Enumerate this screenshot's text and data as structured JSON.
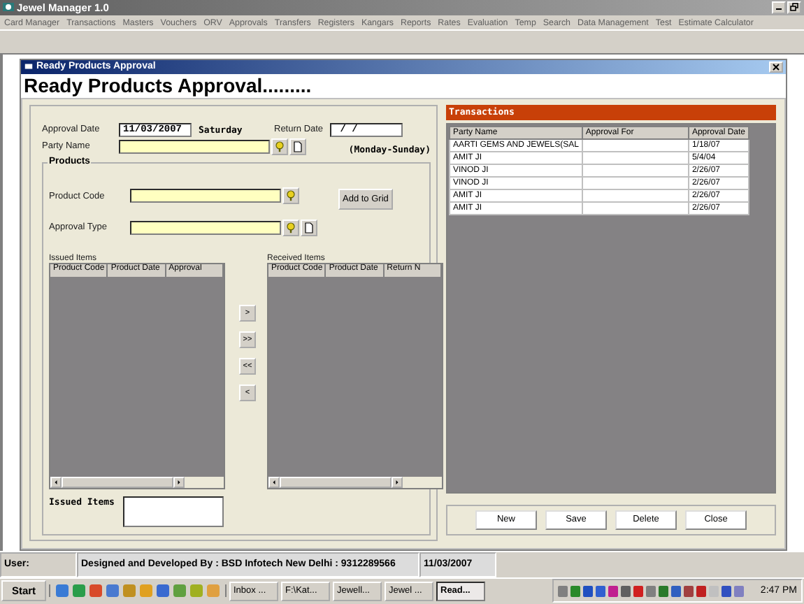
{
  "app_window": {
    "title": "Jewel Manager 1.0"
  },
  "menu": [
    "Card Manager",
    "Transactions",
    "Masters",
    "Vouchers",
    "ORV",
    "Approvals",
    "Transfers",
    "Registers",
    "Kangars",
    "Reports",
    "Rates",
    "Evaluation",
    "Temp",
    "Search",
    "Data Management",
    "Test",
    "Estimate Calculator"
  ],
  "child_window": {
    "title": "Ready Products Approval"
  },
  "heading": "Ready Products Approval.........",
  "form": {
    "approval_date": {
      "label": "Approval Date",
      "value": "11/03/2007",
      "day": "Saturday"
    },
    "return_date": {
      "label": "Return Date",
      "value": " / /",
      "hint": "(Monday-Sunday)"
    },
    "party_name": {
      "label": "Party Name"
    }
  },
  "products": {
    "title": "Products",
    "product_code": {
      "label": "Product Code"
    },
    "approval_type": {
      "label": "Approval Type"
    },
    "add_button": "Add to Grid"
  },
  "issued_items": {
    "title": "Issued Items",
    "columns": [
      "Product Code",
      "Product Date",
      "Approval"
    ]
  },
  "received_items": {
    "title": "Received Items",
    "columns": [
      "Product Code",
      "Product Date",
      "Return N"
    ]
  },
  "move_buttons": [
    ">",
    ">>",
    "<<",
    "<"
  ],
  "issued_items_note": {
    "label": "Issued Items"
  },
  "transactions": {
    "title": "Transactions",
    "columns": [
      "Party Name",
      "Approval For",
      "Approval Date"
    ],
    "rows": [
      [
        "AARTI GEMS AND JEWELS(SAL",
        "",
        "1/18/07"
      ],
      [
        "AMIT JI",
        "",
        "5/4/04"
      ],
      [
        "VINOD JI",
        "",
        "2/26/07"
      ],
      [
        "VINOD JI",
        "",
        "2/26/07"
      ],
      [
        "AMIT JI",
        "",
        "2/26/07"
      ],
      [
        "AMIT JI",
        "",
        "2/26/07"
      ]
    ]
  },
  "actions": [
    "New",
    "Save",
    "Delete",
    "Close"
  ],
  "status_bar": [
    "User:",
    "Designed and Developed By : BSD Infotech New Delhi : 9312289566",
    "11/03/2007"
  ],
  "taskbar": {
    "start": "Start",
    "tasks": [
      {
        "label": "Inbox ...",
        "selected": false
      },
      {
        "label": "F:\\Kat...",
        "selected": false
      },
      {
        "label": "Jewell...",
        "selected": false
      },
      {
        "label": "Jewel ...",
        "selected": false
      },
      {
        "label": "Read...",
        "selected": true
      }
    ],
    "clock": "2:47 PM"
  }
}
